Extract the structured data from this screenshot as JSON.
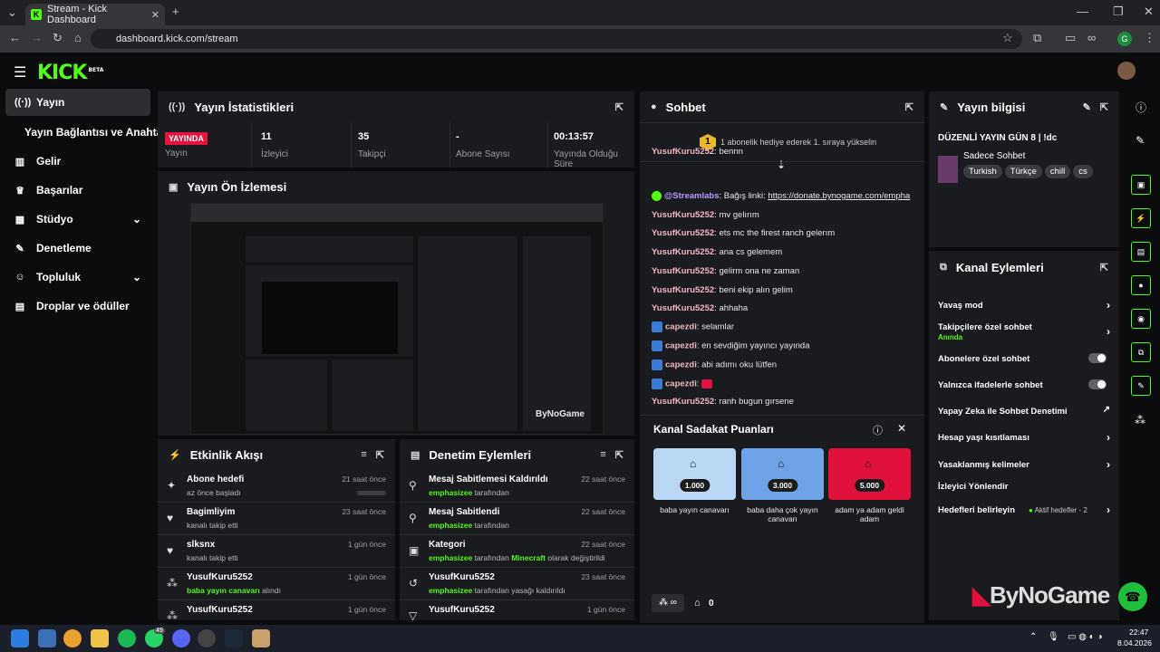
{
  "browser": {
    "tab_title": "Stream - Kick Dashboard",
    "url": "dashboard.kick.com/stream",
    "profile_initial": "G"
  },
  "brand": {
    "logo": "KICK",
    "logo_sup": "BETA"
  },
  "sidebar": {
    "items": [
      {
        "label": "Yayın",
        "icon": "broadcast-icon"
      },
      {
        "label": "Yayın Bağlantısı ve Anahtarı",
        "icon": ""
      },
      {
        "label": "Gelir",
        "icon": "chart-icon"
      },
      {
        "label": "Başarılar",
        "icon": "trophy-icon"
      },
      {
        "label": "Stüdyo",
        "icon": "studio-icon"
      },
      {
        "label": "Denetleme",
        "icon": "wrench-icon"
      },
      {
        "label": "Topluluk",
        "icon": "people-icon"
      },
      {
        "label": "Droplar ve ödüller",
        "icon": "gift-icon"
      }
    ]
  },
  "stats": {
    "title": "Yayın İstatistikleri",
    "live_badge": "YAYINDA",
    "live_label": "Yayın",
    "items": [
      {
        "value": "11",
        "label": "İzleyici"
      },
      {
        "value": "35",
        "label": "Takipçi"
      },
      {
        "value": "-",
        "label": "Abone Sayısı"
      },
      {
        "value": "00:13:57",
        "label": "Yayında Olduğu Süre"
      }
    ]
  },
  "preview": {
    "title": "Yayın Ön İzlemesi",
    "watermark": "ByNoGame"
  },
  "activity": {
    "title": "Etkinlik Akışı",
    "rows": [
      {
        "title": "Abone hedefi",
        "sub": "az önce başladı",
        "time": "21 saat önce"
      },
      {
        "title": "Bagimliyim",
        "sub": "kanalı takip etti",
        "time": "23 saat önce"
      },
      {
        "title": "slksnx",
        "sub": "kanalı takip etti",
        "time": "1 gün önce"
      },
      {
        "title": "YusufKuru5252",
        "sub_green": "baba yayın canavarı",
        "sub": " alındı",
        "time": "1 gün önce"
      },
      {
        "title": "YusufKuru5252",
        "sub": "",
        "time": "1 gün önce"
      }
    ]
  },
  "moderation": {
    "title": "Denetim Eylemleri",
    "rows": [
      {
        "title": "Mesaj Sabitlemesi Kaldırıldı",
        "sub_green": "emphasizee",
        "sub": " tarafından",
        "time": "22 saat önce"
      },
      {
        "title": "Mesaj Sabitlendi",
        "sub_green": "emphasizee",
        "sub": " tarafından",
        "time": "22 saat önce"
      },
      {
        "title": "Kategori",
        "sub_green": "emphasizee",
        "sub": " tarafından ",
        "sub_green2": "Minecraft",
        "sub2": " olarak değiştirildi",
        "time": "22 saat önce"
      },
      {
        "title": "YusufKuru5252",
        "sub_green": "emphasizee",
        "sub": " tarafından yasağı kaldırıldı",
        "time": "23 saat önce"
      },
      {
        "title": "YusufKuru5252",
        "sub": "",
        "time": "1 gün önce"
      }
    ]
  },
  "chat": {
    "title": "Sohbet",
    "gift_notice": "1 abonelik hediye ederek 1. sıraya yükselin",
    "gift_rank": "1",
    "messages": [
      {
        "user": "YusufKuru5252",
        "text": "bennn"
      },
      {
        "user": "@Streamlabs",
        "text": "Bağış linki: ",
        "link": "https://donate.bynogame.com/empha"
      },
      {
        "user": "YusufKuru5252",
        "text": "mv gelırım"
      },
      {
        "user": "YusufKuru5252",
        "text": "ets mc the firest ranch gelerım"
      },
      {
        "user": "YusufKuru5252",
        "text": "ana cs gelemem"
      },
      {
        "user": "YusufKuru5252",
        "text": "gelirm ona ne zaman"
      },
      {
        "user": "YusufKuru5252",
        "text": "beni ekip alın gelim"
      },
      {
        "user": "YusufKuru5252",
        "text": "ahhaha"
      },
      {
        "user": "capezdi",
        "text": "selamlar"
      },
      {
        "user": "capezdi",
        "text": "en sevdiğim yayıncı yayında"
      },
      {
        "user": "capezdi",
        "text": "abi adımı oku lütfen"
      },
      {
        "user": "capezdi",
        "text": ""
      },
      {
        "user": "YusufKuru5252",
        "text": "ranh bugun gırsene"
      }
    ],
    "loyalty": {
      "title": "Kanal Sadakat Puanları",
      "rewards": [
        {
          "cost": "1.000",
          "label": "baba yayın canavarı",
          "color": "#b9d6f5"
        },
        {
          "cost": "3.000",
          "label": "baba daha çok yayın canavarı",
          "color": "#6fa3e8"
        },
        {
          "cost": "5.000",
          "label": "adam ya adam geldi adam",
          "color": "#e0123d"
        }
      ]
    },
    "footer_count": "0"
  },
  "stream_info": {
    "title": "Yayın bilgisi",
    "stream_title": "DÜZENLİ YAYIN GÜN 8 | !dc",
    "category": "Sadece Sohbet",
    "tags": [
      "Turkish",
      "Türkçe",
      "chill",
      "cs"
    ]
  },
  "channel_actions": {
    "title": "Kanal Eylemleri",
    "items": [
      {
        "label": "Yavaş mod",
        "control": "chevron"
      },
      {
        "label": "Takipçilere özel sohbet",
        "sub": "Anında",
        "control": "chevron"
      },
      {
        "label": "Abonelere özel sohbet",
        "control": "toggle"
      },
      {
        "label": "Yalnızca ifadelerle sohbet",
        "control": "toggle"
      },
      {
        "label": "Yapay Zeka ile Sohbet Denetimi",
        "control": "external"
      },
      {
        "label": "Hesap yaşı kısıtlaması",
        "control": "chevron"
      },
      {
        "label": "Yasaklanmış kelimeler",
        "control": "chevron"
      },
      {
        "label": "İzleyici Yönlendir",
        "control": "none"
      },
      {
        "label": "Hedefleri belirleyin",
        "extra": "Aktif hedefler - 2",
        "control": "chevron"
      }
    ]
  },
  "taskbar": {
    "time": "22:47",
    "date": "8.04.2026",
    "whatsapp_badge": "49"
  },
  "colors": {
    "accent": "#53fc18",
    "panel": "#191b1f",
    "live": "#e5123d"
  }
}
